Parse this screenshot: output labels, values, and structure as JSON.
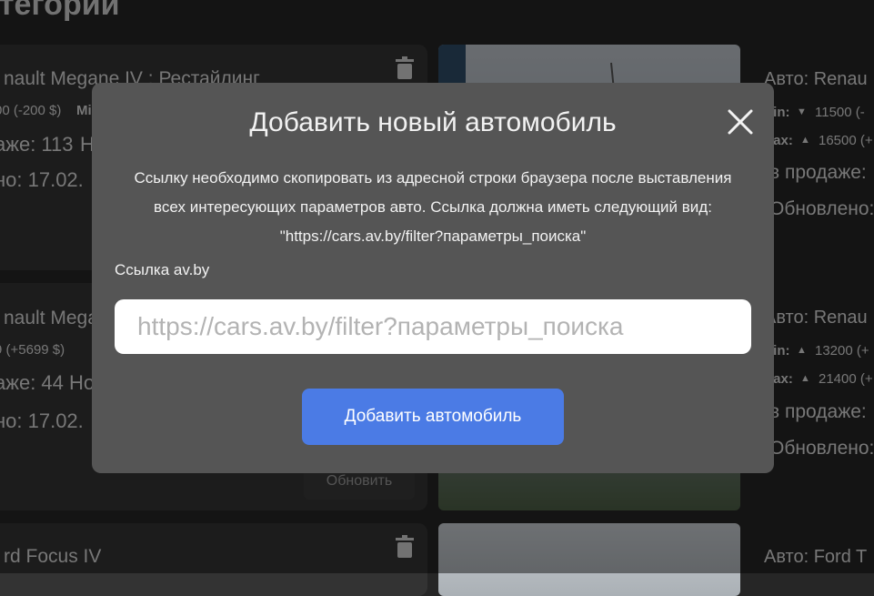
{
  "page": {
    "title": "атегории"
  },
  "cards": [
    {
      "model": "nault Megane IV : Рестайлинг",
      "price_change": "00 (-200 $)",
      "price_tag": "Mi",
      "on_sale": "аже: 113",
      "extra": "Н",
      "updated": "но: 17.02.",
      "right_model": "Авто: Renau",
      "min_label": "lin:",
      "min_value": "11500 (-",
      "min_dir": "down",
      "max_label": "lax:",
      "max_value": "16500 (+",
      "max_dir": "up",
      "right_sale": "в продаже:",
      "right_updated": "Обновлено:"
    },
    {
      "model": "nault Megan",
      "price_change": "9 (+5699 $)",
      "price_tag": "",
      "on_sale": "аже: 44",
      "extra": "Но",
      "updated": "но: 17.02.",
      "right_model": "Авто: Renau",
      "min_label": "lin:",
      "min_value": "13200 (+",
      "min_dir": "up",
      "max_label": "lax:",
      "max_value": "21400 (+",
      "max_dir": "up",
      "right_sale": "в продаже:",
      "right_updated": "Обновлено:",
      "update_label": "Обновить"
    },
    {
      "model": "rd Focus IV",
      "right_model": "Авто: Ford T"
    }
  ],
  "modal": {
    "title": "Добавить новый автомобиль",
    "description": "Ссылку необходимо скопировать из адресной строки браузера после выставления всех интересующих параметров авто. Ссылка должна иметь следующий вид: \"https://cars.av.by/filter?параметры_поиска\"",
    "field_label": "Ссылка av.by",
    "input_placeholder": "https://cars.av.by/filter?параметры_поиска",
    "input_value": "",
    "submit_label": "Добавить автомобиль",
    "close_icon": "close-icon"
  },
  "colors": {
    "background": "#262626",
    "card": "#333333",
    "modal": "#555555",
    "accent": "#4b7be5",
    "up": "#1aa01a",
    "down": "#d02a2a"
  }
}
